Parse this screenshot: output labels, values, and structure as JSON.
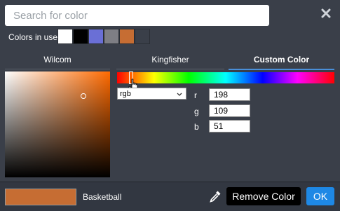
{
  "search": {
    "placeholder": "Search for color",
    "value": ""
  },
  "colors_in_use": {
    "label": "Colors in use",
    "swatches": [
      "#ffffff",
      "#000000",
      "#6a6fd6",
      "#7e7e84",
      "#c66d33",
      "#3a3f49"
    ]
  },
  "tabs": [
    {
      "label": "Wilcom",
      "active": false
    },
    {
      "label": "Kingfisher",
      "active": false
    },
    {
      "label": "Custom Color",
      "active": true
    }
  ],
  "picker": {
    "mode": "rgb",
    "channels": [
      {
        "label": "r",
        "value": "198"
      },
      {
        "label": "g",
        "value": "109"
      },
      {
        "label": "b",
        "value": "51"
      }
    ]
  },
  "footer": {
    "preview_color": "#c66d33",
    "color_name": "Basketball",
    "remove_label": "Remove Color",
    "ok_label": "OK"
  },
  "icons": {
    "close": "close-icon",
    "eyedropper": "eyedropper-icon",
    "cursor": "hand-pointer-icon"
  },
  "accent_color": "#1e88e5"
}
